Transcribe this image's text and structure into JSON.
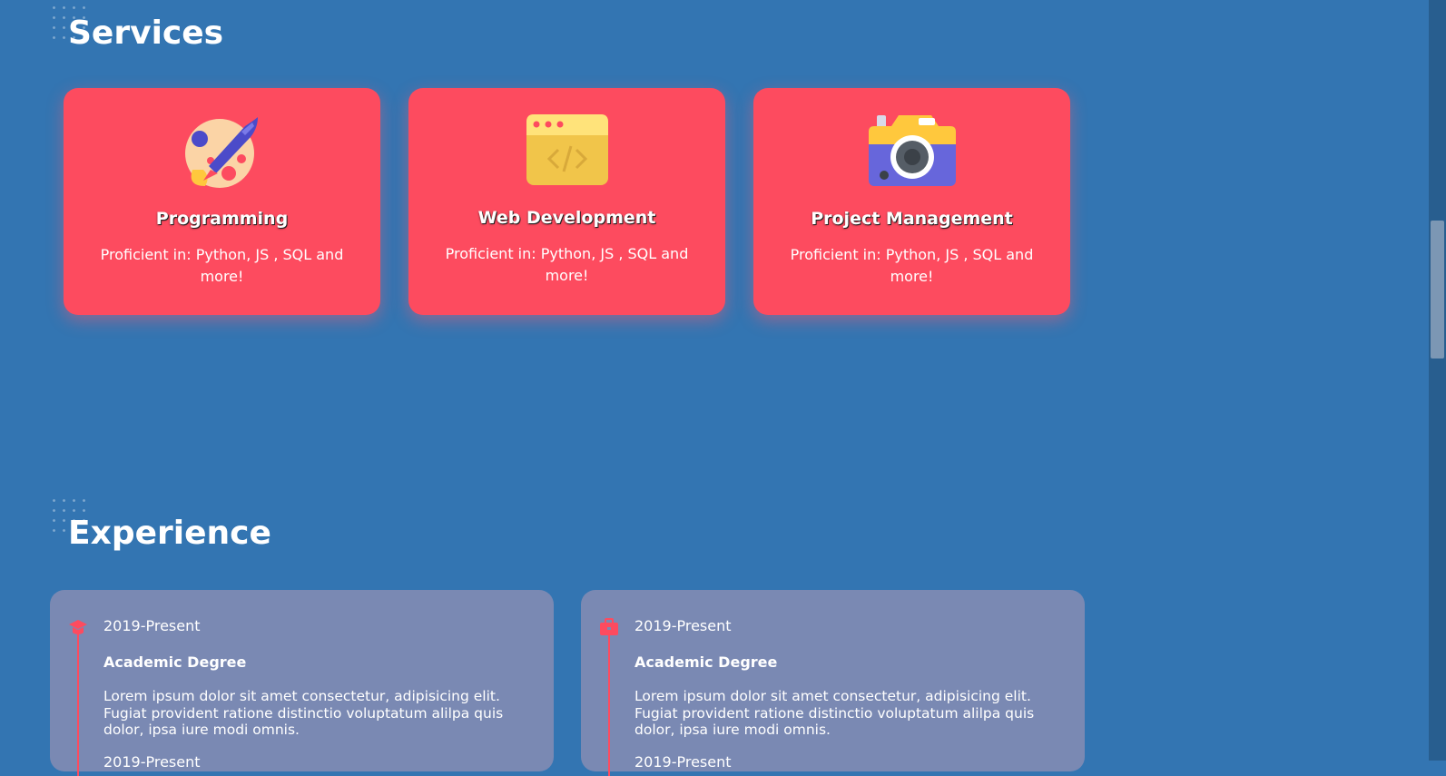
{
  "colors": {
    "background": "#3375b2",
    "card_accent": "#fd4b5f",
    "experience_card": "#7a89b3",
    "text": "#ffffff"
  },
  "services": {
    "title": "Services",
    "cards": [
      {
        "icon": "rocket-palette-icon",
        "title": "Programming",
        "description": "Proficient in: Python, JS , SQL and more!"
      },
      {
        "icon": "code-window-icon",
        "title": "Web Development",
        "description": "Proficient in: Python, JS , SQL and more!"
      },
      {
        "icon": "camera-icon",
        "title": "Project Management",
        "description": "Proficient in: Python, JS , SQL and more!"
      }
    ]
  },
  "experience": {
    "title": "Experience",
    "cards": [
      {
        "icon": "graduation-cap-icon",
        "date": "2019-Present",
        "title": "Academic Degree",
        "description": "Lorem ipsum dolor sit amet consectetur, adipisicing elit. Fugiat provident ratione distinctio voluptatum alilpa quis dolor, ipsa iure modi omnis.",
        "next_date": "2019-Present"
      },
      {
        "icon": "briefcase-icon",
        "date": "2019-Present",
        "title": "Academic Degree",
        "description": "Lorem ipsum dolor sit amet consectetur, adipisicing elit. Fugiat provident ratione distinctio voluptatum alilpa quis dolor, ipsa iure modi omnis.",
        "next_date": "2019-Present"
      }
    ]
  }
}
